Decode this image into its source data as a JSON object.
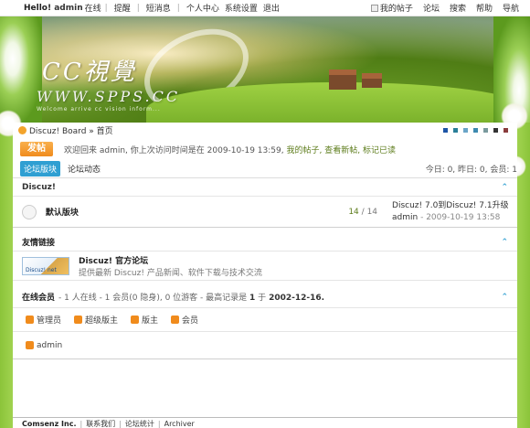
{
  "topbar": {
    "hello": "Hello!",
    "username": "admin",
    "status": "在线",
    "links_left": [
      "提醒",
      "短消息",
      "个人中心",
      "系统设置",
      "退出"
    ],
    "links_right": [
      "我的帖子",
      "论坛",
      "搜索",
      "帮助",
      "导航"
    ]
  },
  "banner": {
    "logo": "CC視覺",
    "url": "WWW.SPPS.CC",
    "slogan": "Welcome arrive cc vision inform..."
  },
  "nav": {
    "breadcrumb": "Discuz! Board » 首页",
    "style_swatches": [
      "#1d55a6",
      "#2a7f99",
      "#6aa5c8",
      "#3d8ab0",
      "#7a9a9e",
      "#333333",
      "#8a3c3c"
    ]
  },
  "welcome": {
    "post_button": "发帖",
    "text": "欢迎回来 admin, 你上次访问时间是在 2009-10-19 13:59,",
    "link_new": "我的帖子, 查看新帖,",
    "link_read": "标记已读"
  },
  "tabs": {
    "active": "论坛版块",
    "other": "论坛动态",
    "stats": "今日: 0, 昨日: 0, 会员: 1"
  },
  "category": {
    "title": "Discuz!",
    "forums": [
      {
        "name": "默认版块",
        "threads": "14",
        "posts": "14",
        "last_title": "Discuz! 7.0到Discuz! 7.1升级图",
        "last_user": "admin",
        "last_time": "- 2009-10-19 13:58"
      }
    ]
  },
  "links_section": {
    "title": "友情链接",
    "logo_text": "Discuz! net",
    "link_title": "Discuz! 官方论坛",
    "link_desc": "提供最新 Discuz! 产品新闻、软件下载与技术交流"
  },
  "online": {
    "title": "在线会员",
    "summary_1": "- 1 人在线 - 1 会员(0 隐身), 0 位游客 - 最高记录是",
    "record_count": "1",
    "summary_2": "于",
    "record_date": "2002-12-16."
  },
  "legend": [
    {
      "label": "管理员",
      "color": "#f08b1c"
    },
    {
      "label": "超级版主",
      "color": "#f08b1c"
    },
    {
      "label": "版主",
      "color": "#f08b1c"
    },
    {
      "label": "会员",
      "color": "#f08b1c"
    }
  ],
  "users": [
    {
      "name": "admin",
      "color": "#f08b1c"
    }
  ],
  "footer": {
    "brand": "Comsenz Inc.",
    "links": [
      "联系我们",
      "论坛统计",
      "Archiver"
    ]
  }
}
